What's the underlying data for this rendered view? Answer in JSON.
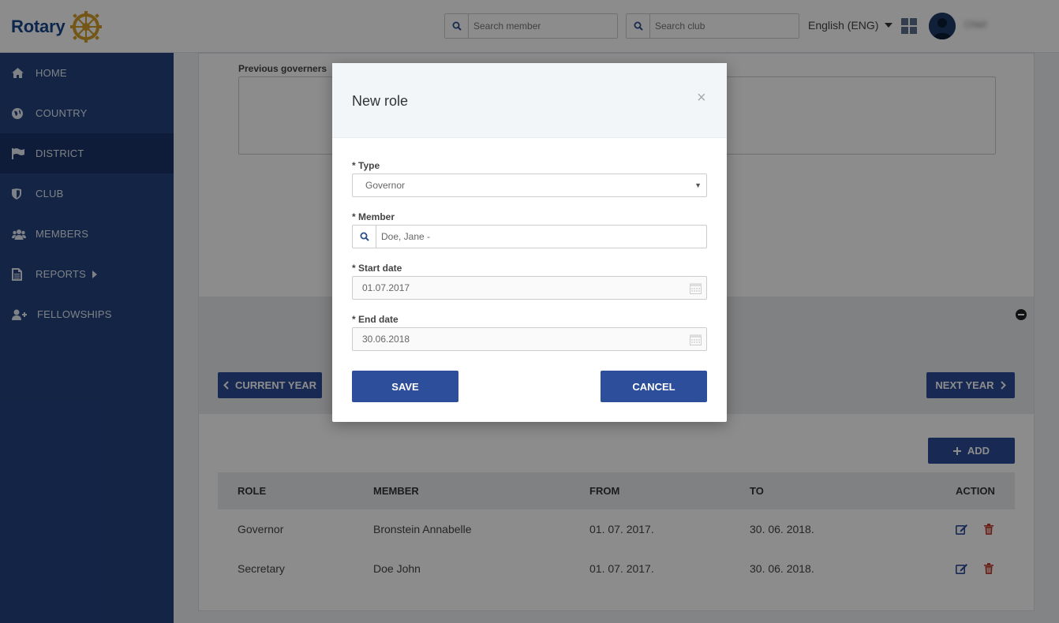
{
  "brand": {
    "name": "Rotary"
  },
  "header": {
    "search_member_placeholder": "Search member",
    "search_club_placeholder": "Search club",
    "language": "English (ENG)",
    "user_name": "Chief"
  },
  "sidebar": {
    "items": [
      {
        "label": "HOME",
        "icon": "home-icon"
      },
      {
        "label": "COUNTRY",
        "icon": "globe-icon"
      },
      {
        "label": "DISTRICT",
        "icon": "flag-icon",
        "active": true
      },
      {
        "label": "CLUB",
        "icon": "shield-icon"
      },
      {
        "label": "MEMBERS",
        "icon": "users-icon"
      },
      {
        "label": "REPORTS",
        "icon": "document-icon",
        "has_submenu": true
      },
      {
        "label": "FELLOWSHIPS",
        "icon": "user-plus-icon"
      }
    ]
  },
  "main": {
    "previous_governors_label": "Previous governers",
    "current_year_label": "CURRENT YEAR",
    "next_year_label": "NEXT YEAR",
    "add_label": "ADD",
    "table": {
      "headers": [
        "ROLE",
        "MEMBER",
        "FROM",
        "TO",
        "ACTION"
      ],
      "rows": [
        {
          "role": "Governor",
          "member": "Bronstein Annabelle",
          "from": "01. 07. 2017.",
          "to": "30. 06. 2018."
        },
        {
          "role": "Secretary",
          "member": "Doe John",
          "from": "01. 07. 2017.",
          "to": "30. 06. 2018."
        }
      ]
    }
  },
  "modal": {
    "title": "New role",
    "close": "×",
    "type_label": "* Type",
    "type_value": "Governor",
    "member_label": "* Member",
    "member_value": "Doe, Jane -",
    "start_label": "* Start date",
    "start_value": "01.07.2017",
    "end_label": "* End date",
    "end_value": "30.06.2018",
    "save_label": "SAVE",
    "cancel_label": "CANCEL"
  },
  "colors": {
    "primary": "#2d4e9a",
    "sidebar": "#23427f",
    "brand_gold": "#d39d2b"
  }
}
